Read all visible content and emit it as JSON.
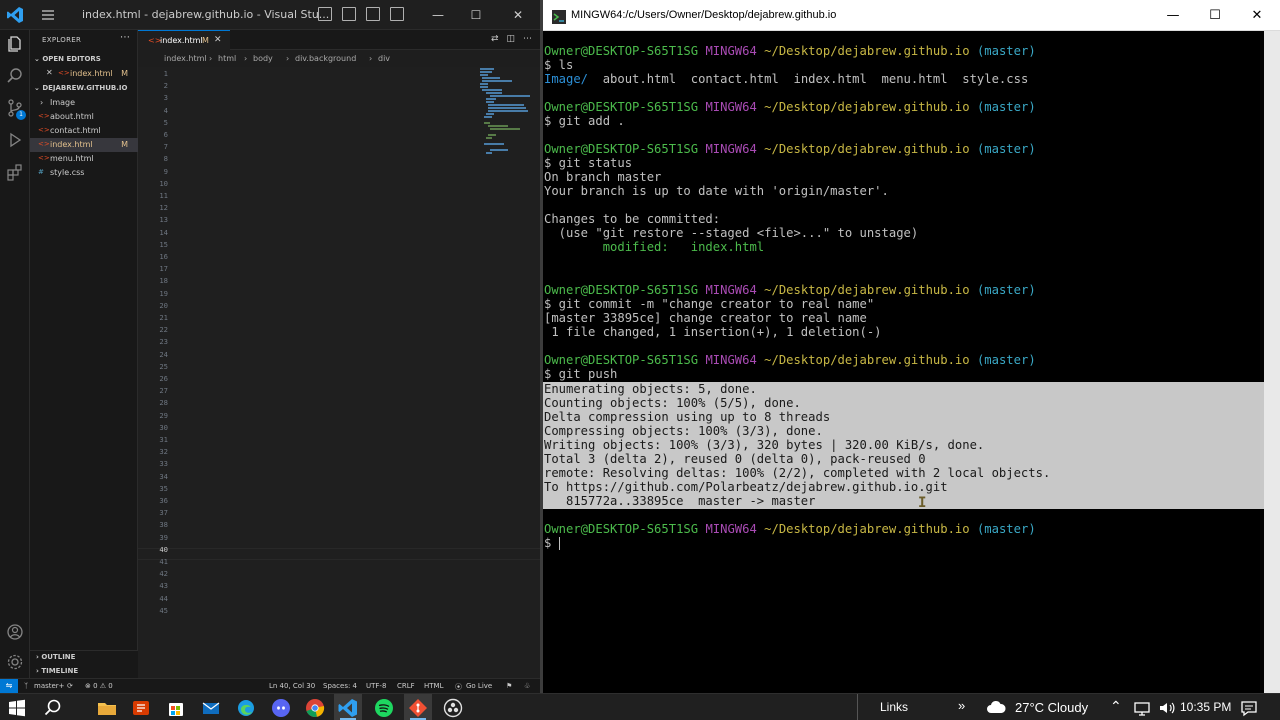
{
  "vscode": {
    "window_title": "index.html - dejabrew.github.io - Visual Stu...",
    "explorer_header": "EXPLORER",
    "open_editors_label": "OPEN EDITORS",
    "open_editors": [
      {
        "name": "index.html",
        "status": "M"
      }
    ],
    "folder_label": "DEJABREW.GITHUB.IO",
    "files": [
      {
        "name": "Image",
        "kind": "folder"
      },
      {
        "name": "about.html",
        "kind": "html"
      },
      {
        "name": "contact.html",
        "kind": "html"
      },
      {
        "name": "index.html",
        "kind": "html",
        "status": "M"
      },
      {
        "name": "menu.html",
        "kind": "html"
      },
      {
        "name": "style.css",
        "kind": "css"
      }
    ],
    "outline_label": "OUTLINE",
    "timeline_label": "TIMELINE",
    "tab": {
      "label": "index.html",
      "status": "M"
    },
    "breadcrumb": [
      "index.html",
      "html",
      "body",
      "div.background",
      "div"
    ],
    "current_line": 40,
    "status_bar": {
      "branch": "master+",
      "problems": "⊗ 0 ⚠ 0",
      "position": "Ln 40, Col 30",
      "spaces": "Spaces: 4",
      "encoding": "UTF-8",
      "eol": "CRLF",
      "language": "HTML",
      "golive": "Go Live"
    }
  },
  "terminal": {
    "window_title": "MINGW64:/c/Users/Owner/Desktop/dejabrew.github.io",
    "prompt_user": "Owner@DESKTOP-S65T1SG",
    "prompt_env": "MINGW64",
    "prompt_path": "~/Desktop/dejabrew.github.io",
    "prompt_branch": "(master)",
    "commands": {
      "ls": "$ ls",
      "add": "$ git add .",
      "status": "$ git status",
      "commit": "$ git commit -m \"change creator to real name\"",
      "push": "$ git push",
      "empty": "$ "
    },
    "ls_output": {
      "dir": "Image/",
      "files": "  about.html  contact.html  index.html  menu.html  style.css"
    },
    "status_output": [
      "On branch master",
      "Your branch is up to date with 'origin/master'.",
      "",
      "Changes to be committed:",
      "  (use \"git restore --staged <file>...\" to unstage)"
    ],
    "modified_line": "        modified:   index.html",
    "commit_output": [
      "[master 33895ce] change creator to real name",
      " 1 file changed, 1 insertion(+), 1 deletion(-)"
    ],
    "push_output": [
      "Enumerating objects: 5, done.",
      "Counting objects: 100% (5/5), done.",
      "Delta compression using up to 8 threads",
      "Compressing objects: 100% (3/3), done.",
      "Writing objects: 100% (3/3), 320 bytes | 320.00 KiB/s, done.",
      "Total 3 (delta 2), reused 0 (delta 0), pack-reused 0",
      "remote: Resolving deltas: 100% (2/2), completed with 2 local objects.",
      "To https://github.com/Polarbeatz/dejabrew.github.io.git",
      "   815772a..33895ce  master -> master"
    ]
  },
  "taskbar": {
    "links_label": "Links",
    "weather": "27°C  Cloudy",
    "time": "10:35 PM"
  }
}
